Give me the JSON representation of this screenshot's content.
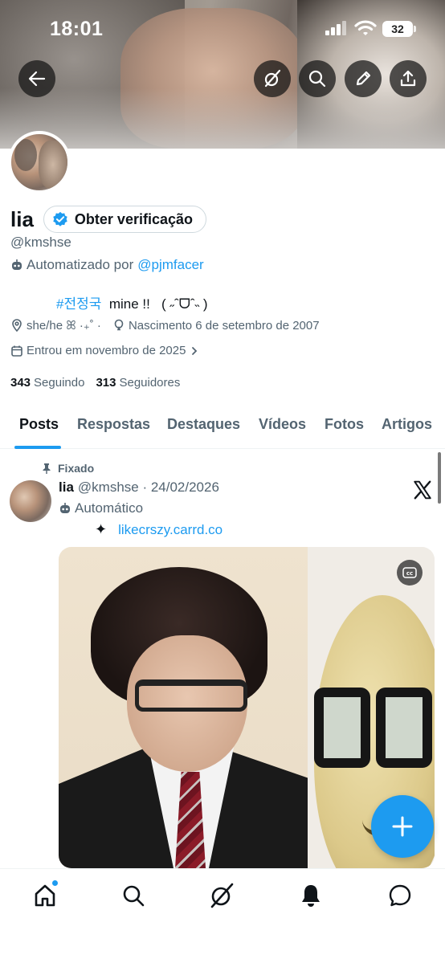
{
  "status_bar": {
    "time": "18:01",
    "battery": "32"
  },
  "profile": {
    "name": "lia",
    "verify_label": "Obter verificação",
    "handle": "@kmshse",
    "automated_prefix": "Automatizado por",
    "automated_by": "@pjmfacer",
    "bio_tag": "#전정국",
    "bio_text": "  mine !!   ( ˶ˆᗜˆ˵ )",
    "pronouns": "she/he ꕤ ·₊˚ ·",
    "birth": "Nascimento 6 de setembro de 2007",
    "joined": "Entrou em novembro de 2025",
    "following_count": "343",
    "following_label": "Seguindo",
    "followers_count": "313",
    "followers_label": "Seguidores"
  },
  "tabs": [
    "Posts",
    "Respostas",
    "Destaques",
    "Vídeos",
    "Fotos",
    "Artigos"
  ],
  "post": {
    "pinned_label": "Fixado",
    "author": "lia",
    "meta": "@kmshse · 24/02/2026",
    "auto_label": "Automático",
    "star": "✦",
    "link": "likecrszy.carrd.co",
    "cc_label": "cc"
  },
  "colors": {
    "accent": "#1d9bf0",
    "text": "#0f1419",
    "muted": "#536471"
  },
  "icons": {
    "header": [
      "back-arrow-icon",
      "grok-icon",
      "search-icon",
      "edit-pencil-icon",
      "share-icon"
    ],
    "nav": [
      "home-icon",
      "search-icon",
      "grok-icon",
      "notifications-bell-icon",
      "messages-icon"
    ]
  }
}
